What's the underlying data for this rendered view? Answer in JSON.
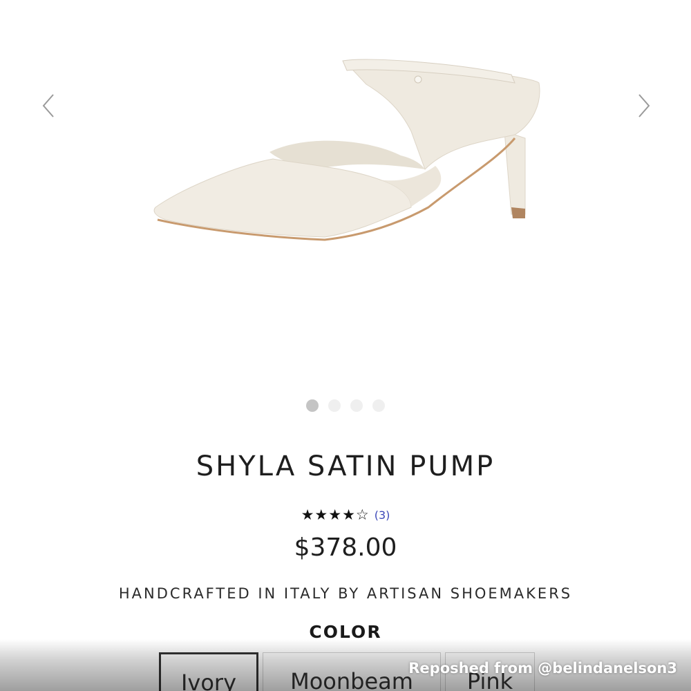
{
  "carousel": {
    "prev_icon": "chevron-left-icon",
    "next_icon": "chevron-right-icon",
    "image_subject": "ivory-pointed-toe-mule-pump",
    "dots": [
      {
        "active": true
      },
      {
        "active": false
      },
      {
        "active": false
      },
      {
        "active": false
      }
    ]
  },
  "product": {
    "title": "SHYLA SATIN PUMP",
    "rating": {
      "value": 4,
      "max": 5,
      "review_count": "(3)"
    },
    "price": "$378.00",
    "tagline": "HANDCRAFTED IN ITALY BY ARTISAN SHOEMAKERS",
    "color_label": "COLOR",
    "colors": [
      {
        "label": "Ivory",
        "selected": true
      },
      {
        "label": "Moonbeam",
        "selected": false
      },
      {
        "label": "Pink",
        "selected": false
      }
    ]
  },
  "overlay": {
    "repost_text": "Reposhed from @belindanelson3"
  },
  "colors": {
    "review_link": "#3b47b8",
    "shoe_fill": "#efeae0",
    "sole": "#c89a6e"
  }
}
